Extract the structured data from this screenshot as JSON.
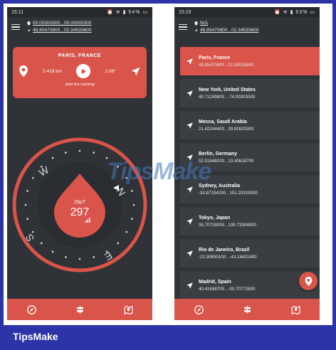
{
  "left": {
    "status": {
      "time": "15:11",
      "battery": "54%"
    },
    "header": {
      "coord1": "00.00000000 , 00.00000000",
      "coord2": "48.85470800 , 02.34533600"
    },
    "card": {
      "city": "PARIS, FRANCE",
      "distance": "5 418 km",
      "bearing": "2.06°",
      "track_label": "start live tracking"
    },
    "compass": {
      "value": "297",
      "unit": "28µT",
      "labels": [
        "W",
        "N",
        "S",
        "E"
      ]
    },
    "nav": [
      "compass-icon",
      "signpost-icon",
      "map-icon"
    ]
  },
  "right": {
    "status": {
      "time": "15:15",
      "battery": "53%"
    },
    "header": {
      "coord1": "N/A",
      "coord2": "48.85470800 , 02.34533600"
    },
    "locations": [
      {
        "name": "Paris, France",
        "coords": "48.85470800 , 02.34533600",
        "active": true
      },
      {
        "name": "New York, United States",
        "coords": "40.71249800 , -74.00303300",
        "active": false
      },
      {
        "name": "Mecca, Saudi Arabia",
        "coords": "21.42244400 , 39.82620300",
        "active": false
      },
      {
        "name": "Berlin, Germany",
        "coords": "52.51846200 , 13.40618700",
        "active": false
      },
      {
        "name": "Sydney, Australia",
        "coords": "-33.87154200 , 151.20319300",
        "active": false
      },
      {
        "name": "Tokyo, Japan",
        "coords": "35.70728000 , 139.73304000",
        "active": false
      },
      {
        "name": "Rio de Janeiro, Brazil",
        "coords": "-22.90850100 , -43.18421400",
        "active": false
      },
      {
        "name": "Madrid, Spain",
        "coords": "40.41638700 , -03.70772800",
        "active": false
      }
    ]
  },
  "watermark": "TipsMake",
  "brand": "TipsMake",
  "colors": {
    "accent": "#d9544a",
    "background": "#2f3236",
    "frame": "#2d34a8"
  }
}
